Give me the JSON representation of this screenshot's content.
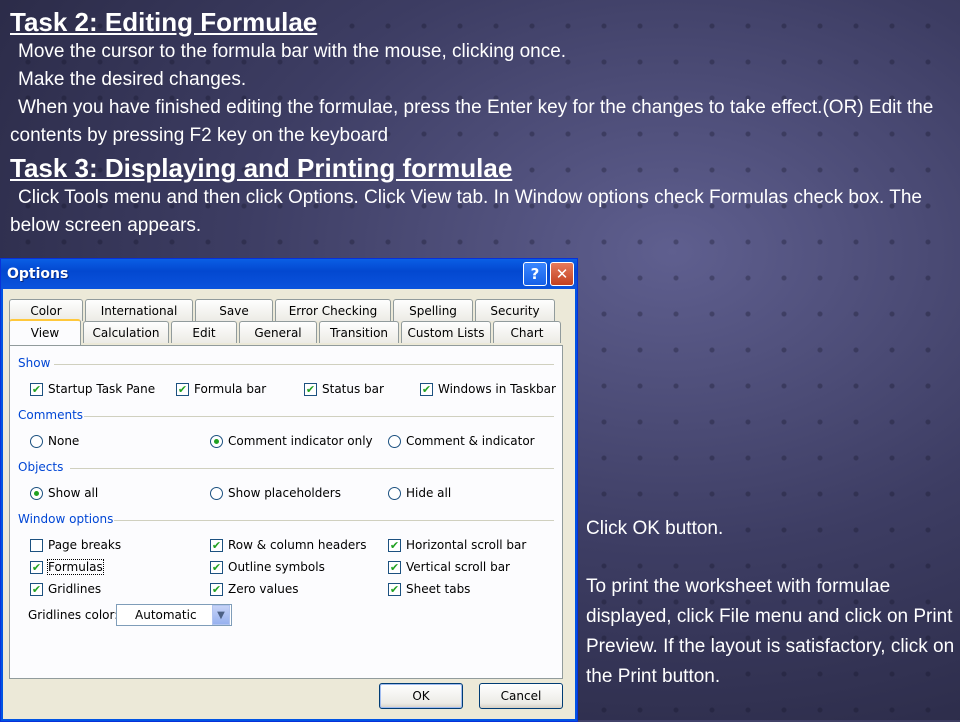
{
  "slide": {
    "task2_heading": "Task 2: Editing Formulae",
    "task2_lines": [
      "Move the cursor to the formula bar with the mouse, clicking once.",
      "Make the desired changes.",
      "When you have finished editing the formulae, press the Enter key for the changes to take effect.(OR) Edit the contents by pressing F2 key on the keyboard"
    ],
    "task3_heading": "Task 3: Displaying and Printing formulae",
    "task3_line": "Click Tools menu and then click Options.  Click View tab.  In Window options check Formulas check box. The below screen appears.",
    "side_line1": "Click OK button.",
    "side_line2": "To print the worksheet with formulae displayed, click File menu and click on Print Preview. If the layout is satisfactory, click on the Print button."
  },
  "dialog": {
    "title": "Options",
    "help_glyph": "?",
    "close_glyph": "✕",
    "tabs_row1": [
      "Color",
      "International",
      "Save",
      "Error Checking",
      "Spelling",
      "Security"
    ],
    "tabs_row2": [
      "View",
      "Calculation",
      "Edit",
      "General",
      "Transition",
      "Custom Lists",
      "Chart"
    ],
    "active_tab": "View",
    "show": {
      "label": "Show",
      "options": [
        {
          "label": "Startup Task Pane",
          "checked": true
        },
        {
          "label": "Formula bar",
          "checked": true
        },
        {
          "label": "Status bar",
          "checked": true
        },
        {
          "label": "Windows in Taskbar",
          "checked": true
        }
      ]
    },
    "comments": {
      "label": "Comments",
      "options": [
        {
          "label": "None",
          "selected": false
        },
        {
          "label": "Comment indicator only",
          "selected": true
        },
        {
          "label": "Comment & indicator",
          "selected": false
        }
      ]
    },
    "objects": {
      "label": "Objects",
      "options": [
        {
          "label": "Show all",
          "selected": true
        },
        {
          "label": "Show placeholders",
          "selected": false
        },
        {
          "label": "Hide all",
          "selected": false
        }
      ]
    },
    "window_options": {
      "label": "Window options",
      "options": [
        {
          "label": "Page breaks",
          "checked": false
        },
        {
          "label": "Row & column headers",
          "checked": true
        },
        {
          "label": "Horizontal scroll bar",
          "checked": true
        },
        {
          "label": "Formulas",
          "checked": true
        },
        {
          "label": "Outline symbols",
          "checked": true
        },
        {
          "label": "Vertical scroll bar",
          "checked": true
        },
        {
          "label": "Gridlines",
          "checked": true
        },
        {
          "label": "Zero values",
          "checked": true
        },
        {
          "label": "Sheet tabs",
          "checked": true
        }
      ],
      "gridlines_color_label": "Gridlines color:",
      "gridlines_color_value": "Automatic"
    },
    "ok_label": "OK",
    "cancel_label": "Cancel"
  }
}
